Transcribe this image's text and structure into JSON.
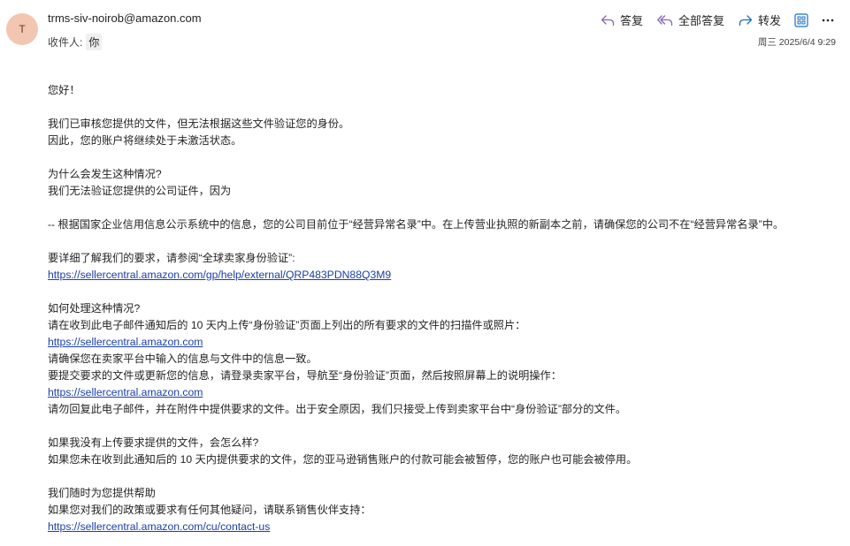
{
  "header": {
    "avatar_initial": "T",
    "sender": "trms-siv-noirob@amazon.com",
    "recipients_label": "收件人:",
    "recipient": "你",
    "timestamp": "周三 2025/6/4 9:29",
    "accent_color": "#8764b8"
  },
  "toolbar": {
    "reply": "答复",
    "reply_all": "全部答复",
    "forward": "转发",
    "apps_icon": "apps-icon",
    "more_icon": "more-icon"
  },
  "body": {
    "greeting": "您好！",
    "p1_l1": "我们已审核您提供的文件，但无法根据这些文件验证您的身份。",
    "p1_l2": "因此，您的账户将继续处于未激活状态。",
    "p2_l1": "为什么会发生这种情况?",
    "p2_l2": "我们无法验证您提供的公司证件，因为",
    "p3": "-- 根据国家企业信用信息公示系统中的信息，您的公司目前位于“经营异常名录”中。在上传营业执照的新副本之前，请确保您的公司不在“经营异常名录”中。",
    "p4_l1": "要详细了解我们的要求，请参阅“全球卖家身份验证”:",
    "p4_link": "https://sellercentral.amazon.com/gp/help/external/QRP483PDN88Q3M9",
    "p5_l1": "如何处理这种情况?",
    "p5_l2": "请在收到此电子邮件通知后的 10 天内上传“身份验证”页面上列出的所有要求的文件的扫描件或照片：",
    "p5_link1": "https://sellercentral.amazon.com",
    "p5_l3": "请确保您在卖家平台中输入的信息与文件中的信息一致。",
    "p5_l4": "要提交要求的文件或更新您的信息，请登录卖家平台，导航至“身份验证”页面，然后按照屏幕上的说明操作：",
    "p5_link2": "https://sellercentral.amazon.com",
    "p5_l5": "请勿回复此电子邮件，并在附件中提供要求的文件。出于安全原因，我们只接受上传到卖家平台中“身份验证”部分的文件。",
    "p6_l1": "如果我没有上传要求提供的文件，会怎么样?",
    "p6_l2": "如果您未在收到此通知后的 10 天内提供要求的文件，您的亚马逊销售账户的付款可能会被暂停，您的账户也可能会被停用。",
    "p7_l1": "我们随时为您提供帮助",
    "p7_l2": "如果您对我们的政策或要求有任何其他疑问，请联系销售伙伴支持：",
    "p7_link": "https://sellercentral.amazon.com/cu/contact-us"
  }
}
